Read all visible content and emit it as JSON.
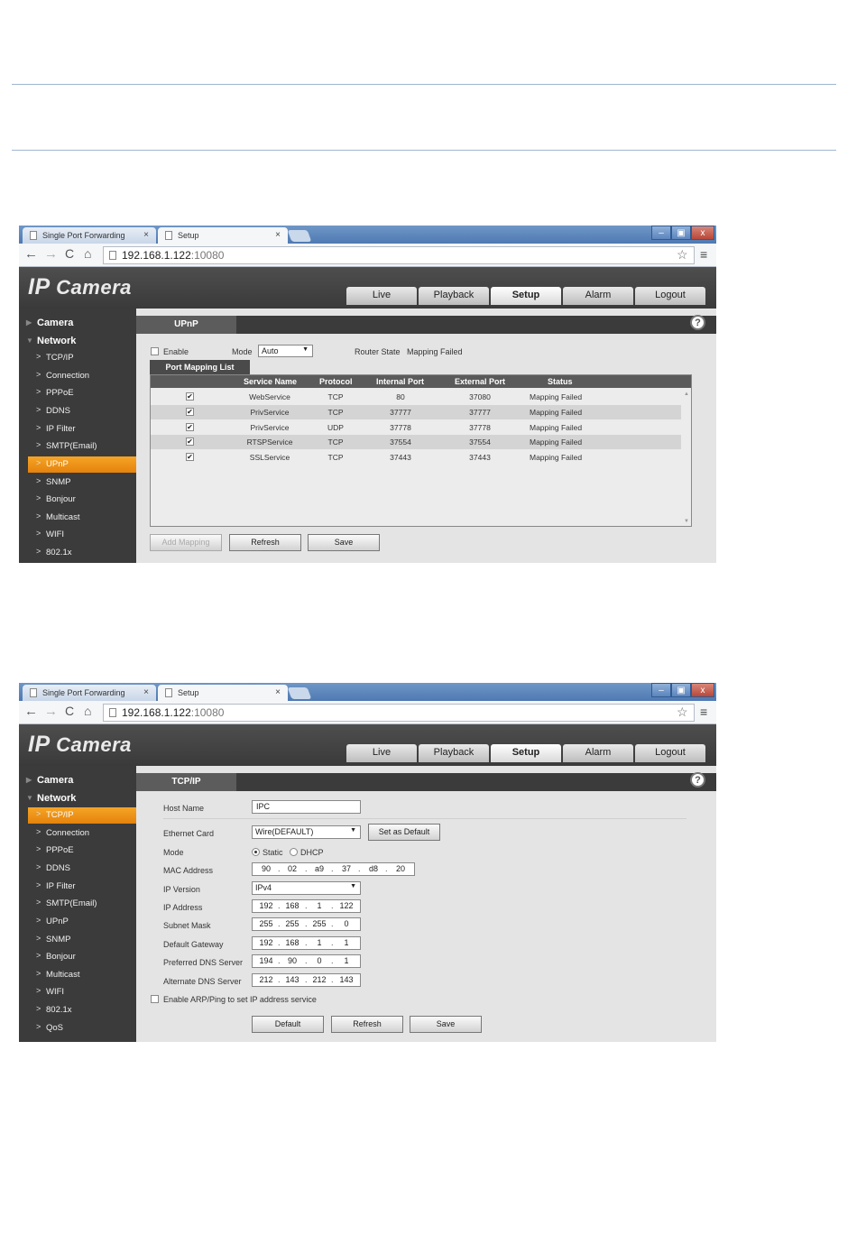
{
  "browser": {
    "tab_inactive": "Single Port Forwarding",
    "tab_active": "Setup",
    "tab_close": "×",
    "url_host": "192.168.1.122",
    "url_port": ":10080",
    "back": "←",
    "forward": "→",
    "reload": "C",
    "home": "⌂",
    "star": "☆",
    "menu": "≡",
    "min": "–",
    "max": "▣",
    "close": "x"
  },
  "app": {
    "logo_ip": "IP",
    "logo_camera": "Camera",
    "nav": [
      "Live",
      "Playback",
      "Setup",
      "Alarm",
      "Logout"
    ],
    "help": "?"
  },
  "sidebar": {
    "camera": "Camera",
    "network": "Network",
    "items": [
      "TCP/IP",
      "Connection",
      "PPPoE",
      "DDNS",
      "IP Filter",
      "SMTP(Email)",
      "UPnP",
      "SNMP",
      "Bonjour",
      "Multicast",
      "WIFI",
      "802.1x",
      "QoS"
    ]
  },
  "upnp": {
    "tab": "UPnP",
    "enable_label": "Enable",
    "mode_label": "Mode",
    "mode_value": "Auto",
    "router_state_label": "Router State",
    "router_state_value": "Mapping Failed",
    "list_tab": "Port Mapping List",
    "columns": [
      "Service Name",
      "Protocol",
      "Internal Port",
      "External Port",
      "Status"
    ],
    "rows": [
      {
        "service": "WebService",
        "protocol": "TCP",
        "internal": "80",
        "external": "37080",
        "status": "Mapping Failed"
      },
      {
        "service": "PrivService",
        "protocol": "TCP",
        "internal": "37777",
        "external": "37777",
        "status": "Mapping Failed"
      },
      {
        "service": "PrivService",
        "protocol": "UDP",
        "internal": "37778",
        "external": "37778",
        "status": "Mapping Failed"
      },
      {
        "service": "RTSPService",
        "protocol": "TCP",
        "internal": "37554",
        "external": "37554",
        "status": "Mapping Failed"
      },
      {
        "service": "SSLService",
        "protocol": "TCP",
        "internal": "37443",
        "external": "37443",
        "status": "Mapping Failed"
      }
    ],
    "check": "✔",
    "buttons": {
      "add": "Add Mapping",
      "refresh": "Refresh",
      "save": "Save"
    }
  },
  "tcpip": {
    "tab": "TCP/IP",
    "host_name_label": "Host Name",
    "host_name_value": "IPC",
    "ethernet_label": "Ethernet Card",
    "ethernet_value": "Wire(DEFAULT)",
    "set_default": "Set as Default",
    "mode_label": "Mode",
    "mode_static": "Static",
    "mode_dhcp": "DHCP",
    "mac_label": "MAC Address",
    "mac": [
      "90",
      "02",
      "a9",
      "37",
      "d8",
      "20"
    ],
    "ipver_label": "IP Version",
    "ipver_value": "IPv4",
    "ip_label": "IP Address",
    "ip": [
      "192",
      "168",
      "1",
      "122"
    ],
    "mask_label": "Subnet Mask",
    "mask": [
      "255",
      "255",
      "255",
      "0"
    ],
    "gw_label": "Default Gateway",
    "gw": [
      "192",
      "168",
      "1",
      "1"
    ],
    "dns1_label": "Preferred DNS Server",
    "dns1": [
      "194",
      "90",
      "0",
      "1"
    ],
    "dns2_label": "Alternate DNS Server",
    "dns2": [
      "212",
      "143",
      "212",
      "143"
    ],
    "arp_label": "Enable ARP/Ping to set IP address service",
    "buttons": {
      "default": "Default",
      "refresh": "Refresh",
      "save": "Save"
    }
  },
  "sep": "."
}
